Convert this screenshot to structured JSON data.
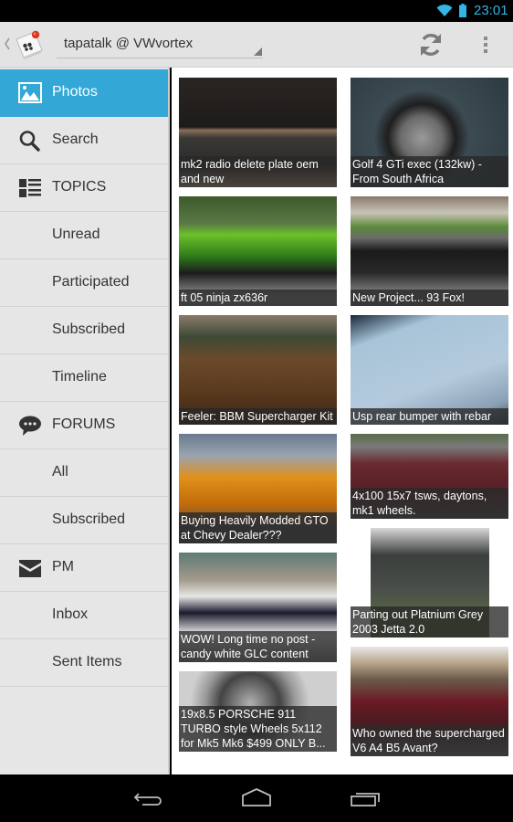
{
  "status_bar": {
    "time": "23:01",
    "wifi_icon": "wifi-icon",
    "battery_icon": "battery-icon",
    "accent": "#33b5e5"
  },
  "action_bar": {
    "up_icon": "chevron-left-icon",
    "logo_icon": "tapatalk-logo-icon",
    "site_title": "tapatalk @ VWvortex",
    "refresh_icon": "refresh-icon",
    "overflow_icon": "overflow-menu-icon"
  },
  "sidebar": {
    "active_color": "#33a7d6",
    "items": [
      {
        "label": "Photos",
        "icon": "photos-icon",
        "active": true
      },
      {
        "label": "Search",
        "icon": "search-icon"
      },
      {
        "label": "TOPICS",
        "icon": "topics-list-icon"
      },
      {
        "label": "Unread"
      },
      {
        "label": "Participated"
      },
      {
        "label": "Subscribed"
      },
      {
        "label": "Timeline"
      },
      {
        "label": "FORUMS",
        "icon": "forums-chat-icon"
      },
      {
        "label": "All"
      },
      {
        "label": "Subscribed"
      },
      {
        "label": "PM",
        "icon": "mail-icon"
      },
      {
        "label": "Inbox"
      },
      {
        "label": "Sent Items"
      }
    ]
  },
  "photos": {
    "left_column": [
      {
        "caption": "mk2 radio delete plate oem and new"
      },
      {
        "caption": "ft 05 ninja zx636r"
      },
      {
        "caption": "Feeler: BBM Supercharger Kit"
      },
      {
        "caption": "Buying Heavily Modded GTO at Chevy Dealer???"
      },
      {
        "caption": "WOW! Long time no post - candy white GLC content"
      },
      {
        "caption": "19x8.5 PORSCHE 911 TURBO style Wheels 5x112 for Mk5 Mk6 $499 ONLY B..."
      }
    ],
    "right_column": [
      {
        "caption": "Golf 4 GTi exec (132kw) - From South Africa"
      },
      {
        "caption": "New Project... 93 Fox!"
      },
      {
        "caption": "Usp rear bumper with rebar"
      },
      {
        "caption": "4x100 15x7 tsws, daytons, mk1 wheels."
      },
      {
        "caption": "Parting out Platnium Grey 2003 Jetta 2.0"
      },
      {
        "caption": "Who owned the supercharged V6 A4 B5 Avant?"
      }
    ]
  },
  "nav_bar": {
    "back_icon": "back-icon",
    "home_icon": "home-icon",
    "recents_icon": "recent-apps-icon"
  }
}
